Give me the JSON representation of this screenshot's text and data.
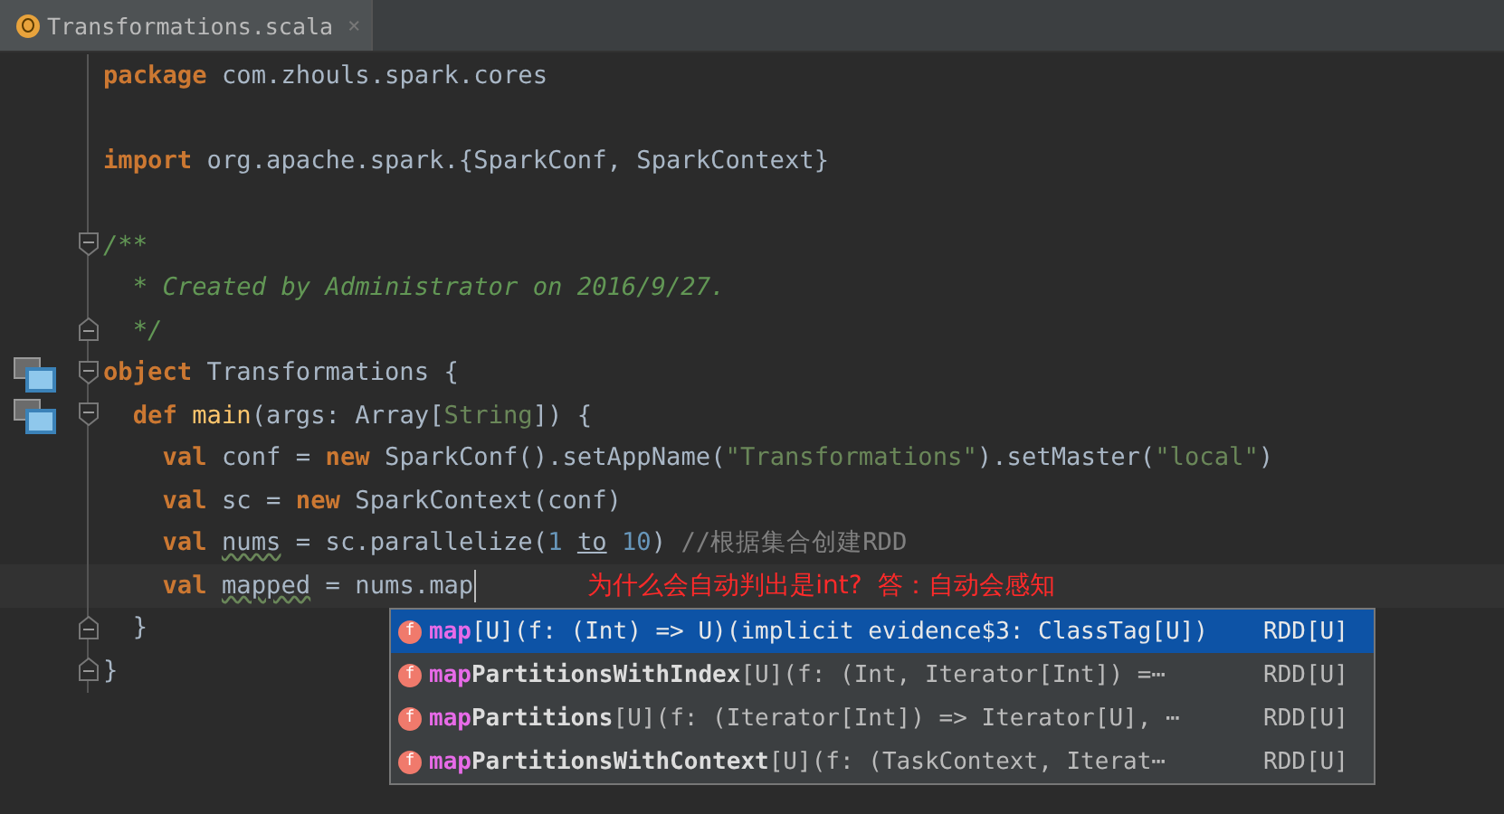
{
  "tabs": [
    {
      "label": "Transformations.scala",
      "selected": true,
      "close": "×"
    }
  ],
  "lines": [
    {
      "kind": "code",
      "tokens": [
        {
          "kind": "keyword",
          "text": "package"
        },
        {
          "kind": "plain",
          "text": " com.zhouls.spark.cores"
        }
      ]
    },
    {
      "kind": "blank"
    },
    {
      "kind": "code",
      "tokens": [
        {
          "kind": "keyword",
          "text": "import"
        },
        {
          "kind": "plain",
          "text": " org.apache.spark.{SparkConf, SparkContext}"
        }
      ]
    },
    {
      "kind": "blank"
    },
    {
      "kind": "code",
      "tokens": [
        {
          "kind": "doc",
          "text": "/**"
        }
      ],
      "children": [
        {
          "kind": "code",
          "tokens": [
            {
              "kind": "doc",
              "text": "* Created by Administrator on 2016/9/27."
            }
          ]
        },
        {
          "kind": "code",
          "fold_end": true,
          "tokens": [
            {
              "kind": "doc",
              "text": "*/"
            }
          ]
        }
      ]
    },
    {
      "kind": "code",
      "marker": true,
      "tokens": [
        {
          "kind": "keyword",
          "text": "object"
        },
        {
          "kind": "plain",
          "text": " Transformations {"
        }
      ],
      "closing": "}",
      "children": [
        {
          "kind": "code",
          "marker": true,
          "tokens": [
            {
              "kind": "keyword",
              "text": "def "
            },
            {
              "kind": "function",
              "text": "main"
            },
            {
              "kind": "plain",
              "text": "(args: Array["
            },
            {
              "kind": "type",
              "text": "String"
            },
            {
              "kind": "plain",
              "text": "]) {"
            }
          ],
          "closing": "}",
          "children": [
            {
              "kind": "code",
              "tokens": [
                {
                  "kind": "keyword",
                  "text": "val"
                },
                {
                  "kind": "plain",
                  "text": " conf = "
                },
                {
                  "kind": "keyword",
                  "text": "new"
                },
                {
                  "kind": "plain",
                  "text": " SparkConf().setAppName("
                },
                {
                  "kind": "string",
                  "text": "\"Transformations\""
                },
                {
                  "kind": "plain",
                  "text": ").setMaster("
                },
                {
                  "kind": "string",
                  "text": "\"local\""
                },
                {
                  "kind": "plain",
                  "text": ")"
                }
              ]
            },
            {
              "kind": "code",
              "tokens": [
                {
                  "kind": "keyword",
                  "text": "val"
                },
                {
                  "kind": "plain",
                  "text": " sc = "
                },
                {
                  "kind": "keyword",
                  "text": "new"
                },
                {
                  "kind": "plain",
                  "text": " SparkContext(conf)"
                }
              ]
            },
            {
              "kind": "code",
              "tokens": [
                {
                  "kind": "keyword",
                  "text": "val "
                },
                {
                  "kind": "warning",
                  "text": "nums"
                },
                {
                  "kind": "plain",
                  "text": " = sc.parallelize("
                },
                {
                  "kind": "number",
                  "text": "1 "
                },
                {
                  "kind": "underlined",
                  "text": "to"
                },
                {
                  "kind": "number",
                  "text": " 10"
                },
                {
                  "kind": "plain",
                  "text": ") "
                },
                {
                  "kind": "comment",
                  "text": "//根据集合创建RDD"
                }
              ]
            },
            {
              "kind": "code",
              "current": true,
              "note": "为什么会自动判出是int?  答：自动会感知",
              "tokens": [
                {
                  "kind": "keyword",
                  "text": "val "
                },
                {
                  "kind": "warning",
                  "text": "mapped"
                },
                {
                  "kind": "plain",
                  "text": " = nums.map"
                }
              ]
            }
          ]
        }
      ]
    }
  ],
  "completion": [
    {
      "icon": "f",
      "match": "map",
      "signature": "[U](f: (Int) => U)(implicit evidence$3: ClassTag[U])",
      "returns": "RDD[U]",
      "selected": true
    },
    {
      "icon": "f",
      "match": "map",
      "name": "PartitionsWithIndex",
      "signature": "[U](f: (Int, Iterator[Int]) =⋯",
      "returns": "RDD[U]",
      "selected": false
    },
    {
      "icon": "f",
      "match": "map",
      "name": "Partitions",
      "signature": "[U](f: (Iterator[Int]) => Iterator[U], ⋯",
      "returns": "RDD[U]",
      "selected": false
    },
    {
      "icon": "f",
      "match": "map",
      "name": "PartitionsWithContext",
      "signature": "[U](f: (TaskContext, Iterat⋯",
      "returns": "RDD[U]",
      "selected": false
    }
  ]
}
